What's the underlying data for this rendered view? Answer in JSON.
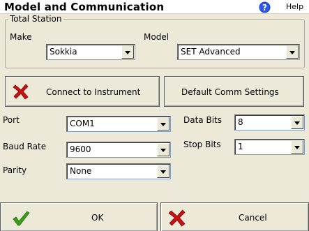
{
  "window": {
    "title": "Model and Communication",
    "help_label": "Help"
  },
  "total_station": {
    "group_label": "Total Station",
    "make_label": "Make",
    "make_value": "Sokkia",
    "model_label": "Model",
    "model_value": "SET Advanced"
  },
  "actions": {
    "connect_label": "Connect to Instrument",
    "default_comm_label": "Default Comm Settings"
  },
  "comm": {
    "port_label": "Port",
    "port_value": "COM1",
    "baud_label": "Baud Rate",
    "baud_value": "9600",
    "parity_label": "Parity",
    "parity_value": "None",
    "data_bits_label": "Data Bits",
    "data_bits_value": "8",
    "stop_bits_label": "Stop Bits",
    "stop_bits_value": "1"
  },
  "footer": {
    "ok_label": "OK",
    "cancel_label": "Cancel"
  },
  "colors": {
    "background": "#ece9d8",
    "help_blue": "#1a3fd0",
    "x_red": "#d01010",
    "check_green": "#3aa018"
  },
  "icons": {
    "help": "help-icon",
    "connect": "red-x-icon",
    "ok": "green-check-icon",
    "cancel": "red-x-icon"
  }
}
